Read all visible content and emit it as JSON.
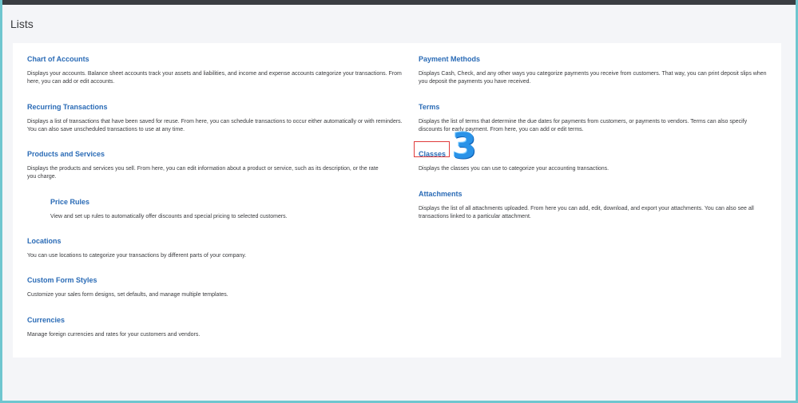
{
  "page": {
    "title": "Lists"
  },
  "left_items": [
    {
      "title": "Chart of Accounts",
      "desc": "Displays your accounts. Balance sheet accounts track your assets and liabilities, and income and expense accounts categorize your transactions. From here, you can add or edit accounts."
    },
    {
      "title": "Recurring Transactions",
      "desc": "Displays a list of transactions that have been saved for reuse. From here, you can schedule transactions to occur either automatically or with reminders. You can also save unscheduled transactions to use at any time."
    },
    {
      "title": "Products and Services",
      "desc": "Displays the products and services you sell. From here, you can edit information about a product or service, such as its description, or the rate you charge."
    },
    {
      "title": "Price Rules",
      "desc": "View and set up rules to automatically offer discounts and special pricing to selected customers."
    },
    {
      "title": "Locations",
      "desc": "You can use locations to categorize your transactions by different parts of your company."
    },
    {
      "title": "Custom Form Styles",
      "desc": "Customize your sales form designs, set defaults, and manage multiple templates."
    },
    {
      "title": "Currencies",
      "desc": "Manage foreign currencies and rates for your customers and vendors."
    }
  ],
  "right_items": [
    {
      "title": "Payment Methods",
      "desc": "Displays Cash, Check, and any other ways you categorize payments you receive from customers. That way, you can print deposit slips when you deposit the payments you have received."
    },
    {
      "title": "Terms",
      "desc": "Displays the list of terms that determine the due dates for payments from customers, or payments to vendors. Terms can also specify discounts for early payment. From here, you can add or edit terms."
    },
    {
      "title": "Classes",
      "desc": "Displays the classes you can use to categorize your accounting transactions."
    },
    {
      "title": "Attachments",
      "desc": "Displays the list of all attachments uploaded. From here you can add, edit, download, and export your attachments. You can also see all transactions linked to a particular attachment."
    }
  ],
  "annotation": {
    "step_number": "3",
    "highlight_color": "#e03c3c",
    "marker_color": "#2a93e8"
  }
}
